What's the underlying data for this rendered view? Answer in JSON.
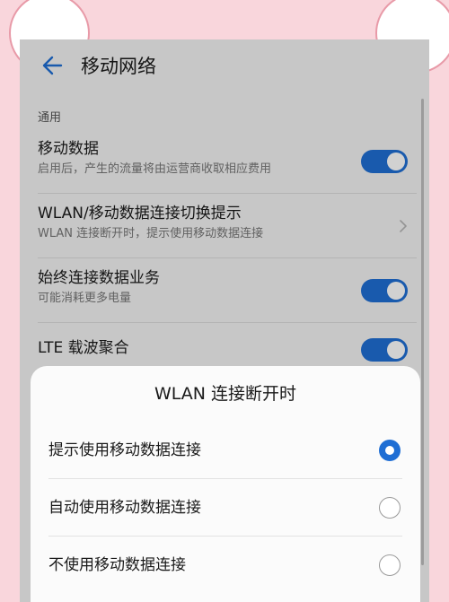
{
  "header": {
    "title": "移动网络"
  },
  "section": {
    "label": "通用"
  },
  "settings": [
    {
      "title": "移动数据",
      "subtitle": "启用后，产生的流量将由运营商收取相应费用",
      "control": "toggle",
      "on": true
    },
    {
      "title": "WLAN/移动数据连接切换提示",
      "subtitle": "WLAN 连接断开时，提示使用移动数据连接",
      "control": "chevron"
    },
    {
      "title": "始终连接数据业务",
      "subtitle": "可能消耗更多电量",
      "control": "toggle",
      "on": true
    },
    {
      "title": "LTE 载波聚合",
      "subtitle": "",
      "control": "toggle",
      "on": true
    }
  ],
  "dialog": {
    "title": "WLAN 连接断开时",
    "options": [
      {
        "label": "提示使用移动数据连接",
        "selected": true
      },
      {
        "label": "自动使用移动数据连接",
        "selected": false
      },
      {
        "label": "不使用移动数据连接",
        "selected": false
      }
    ]
  },
  "colors": {
    "accent": "#1f6ed4",
    "background": "#f9d6dc"
  }
}
